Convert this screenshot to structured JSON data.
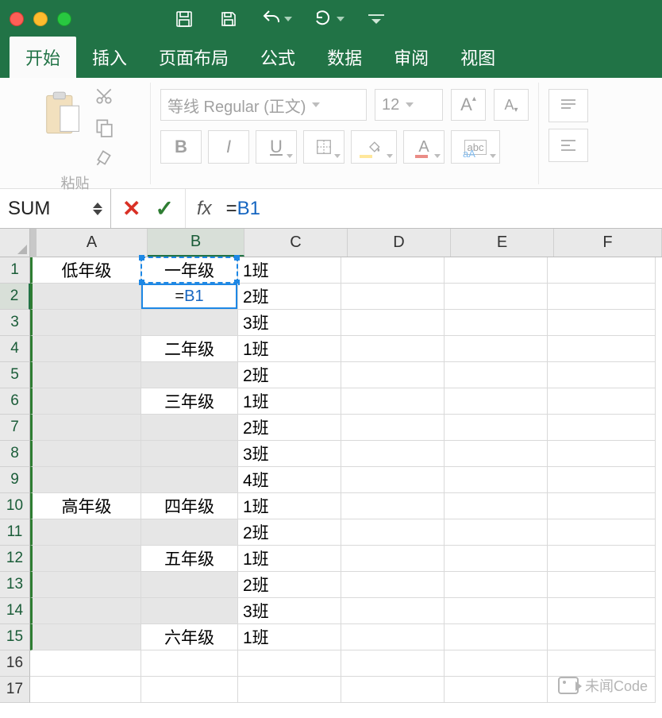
{
  "tabs": {
    "home": "开始",
    "insert": "插入",
    "layout": "页面布局",
    "formula": "公式",
    "data": "数据",
    "review": "审阅",
    "view": "视图"
  },
  "ribbon": {
    "paste_label": "粘贴",
    "font_name": "等线 Regular (正文)",
    "font_size": "12",
    "bold": "B",
    "italic": "I",
    "underline": "U",
    "bigA": "A",
    "smallA": "A",
    "fontcolorA": "A",
    "fillA": "A",
    "abc": "abc"
  },
  "formula_bar": {
    "name_box": "SUM",
    "fx": "fx",
    "prefix": "=",
    "ref": "B1"
  },
  "columns": {
    "A": "A",
    "B": "B",
    "C": "C",
    "D": "D",
    "E": "E",
    "F": "F"
  },
  "rowlabels": {
    "1": "1",
    "2": "2",
    "3": "3",
    "4": "4",
    "5": "5",
    "6": "6",
    "7": "7",
    "8": "8",
    "9": "9",
    "10": "10",
    "11": "11",
    "12": "12",
    "13": "13",
    "14": "14",
    "15": "15",
    "16": "16",
    "17": "17"
  },
  "cells": {
    "A1": "低年级",
    "B1": "一年级",
    "C1": "1班",
    "B2_prefix": "=",
    "B2_ref": "B1",
    "C2": "2班",
    "C3": "3班",
    "B4": "二年级",
    "C4": "1班",
    "C5": "2班",
    "B6": "三年级",
    "C6": "1班",
    "C7": "2班",
    "C8": "3班",
    "C9": "4班",
    "A10": "高年级",
    "B10": "四年级",
    "C10": "1班",
    "C11": "2班",
    "B12": "五年级",
    "C12": "1班",
    "C13": "2班",
    "C14": "3班",
    "B15": "六年级",
    "C15": "1班"
  },
  "watermark": "未闻Code"
}
